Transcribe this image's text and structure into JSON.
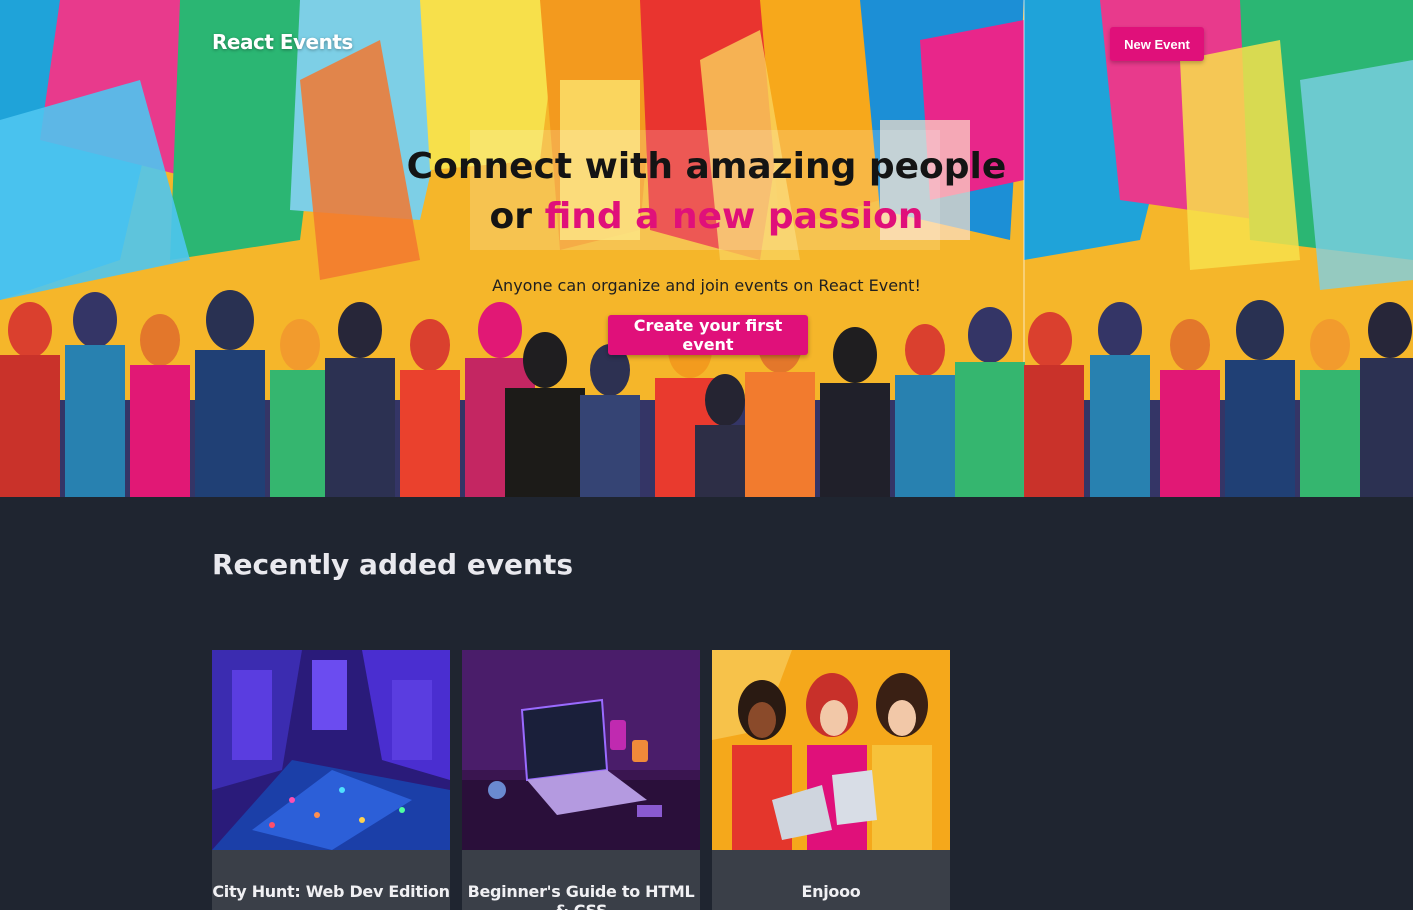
{
  "nav": {
    "brand": "React Events",
    "new_event_label": "New Event"
  },
  "hero": {
    "headline_line1": "Connect with amazing people",
    "headline_or": "or",
    "headline_accent": "find a new passion",
    "subtext": "Anyone can organize and join events on React Event!",
    "cta_label": "Create your first event"
  },
  "section": {
    "title": "Recently added events"
  },
  "events": [
    {
      "title": "City Hunt: Web Dev Edition"
    },
    {
      "title": "Beginner's Guide to HTML & CSS"
    },
    {
      "title": "Enjooo"
    }
  ],
  "colors": {
    "accent": "#e0107a",
    "page_bg": "#1f2530",
    "card_bg": "#3a3f48"
  }
}
